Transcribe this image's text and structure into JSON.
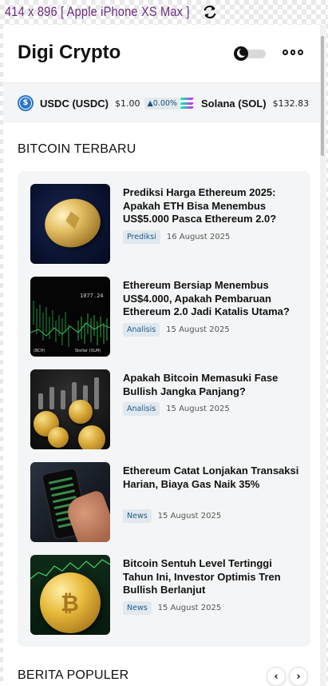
{
  "device": {
    "label": "414 x 896 [ Apple iPhone XS Max ]"
  },
  "header": {
    "brand": "Digi Crypto"
  },
  "ticker": [
    {
      "name": "USDC (USDC)",
      "price": "$1.00",
      "change": "▲0.00%"
    },
    {
      "name": "Solana (SOL)",
      "price": "$132.83"
    }
  ],
  "sections": {
    "latest_title": "BITCOIN TERBARU",
    "popular_title": "BERITA POPULER"
  },
  "news": [
    {
      "title": "Prediksi Harga Ethereum 2025: Apakah ETH Bisa Menembus US$5.000 Pasca Ethereum 2.0?",
      "tag": "Prediksi",
      "date": "16 August 2025"
    },
    {
      "title": "Ethereum Bersiap Menembus US$4.000, Apakah Pembaruan Ethereum 2.0 Jadi Katalis Utama?",
      "tag": "Analisis",
      "date": "15 August 2025"
    },
    {
      "title": "Apakah Bitcoin Memasuki Fase Bullish Jangka Panjang?",
      "tag": "Analisis",
      "date": "15 August 2025"
    },
    {
      "title": "Ethereum Catat Lonjakan Transaksi Harian, Biaya Gas Naik 35%",
      "tag": "News",
      "date": "15 August 2025"
    },
    {
      "title": "Bitcoin Sentuh Level Tertinggi Tahun Ini, Investor Optimis Tren Bullish Berlanjut",
      "tag": "News",
      "date": "15 August 2025"
    }
  ],
  "thumb_text": {
    "price_readout": "1077.24",
    "label_left": "(BCH)",
    "label_right": "Stellar (XLM)"
  },
  "icons": {
    "rotate": "rotate-icon",
    "theme": "moon-toggle-icon",
    "more": "more-dots-icon",
    "prev": "‹",
    "next": "›"
  },
  "colors": {
    "brand_text": "#111111",
    "tag_text": "#1a5a8a",
    "card_bg": "#f4f5f6",
    "device_label": "#6a2b7e"
  }
}
